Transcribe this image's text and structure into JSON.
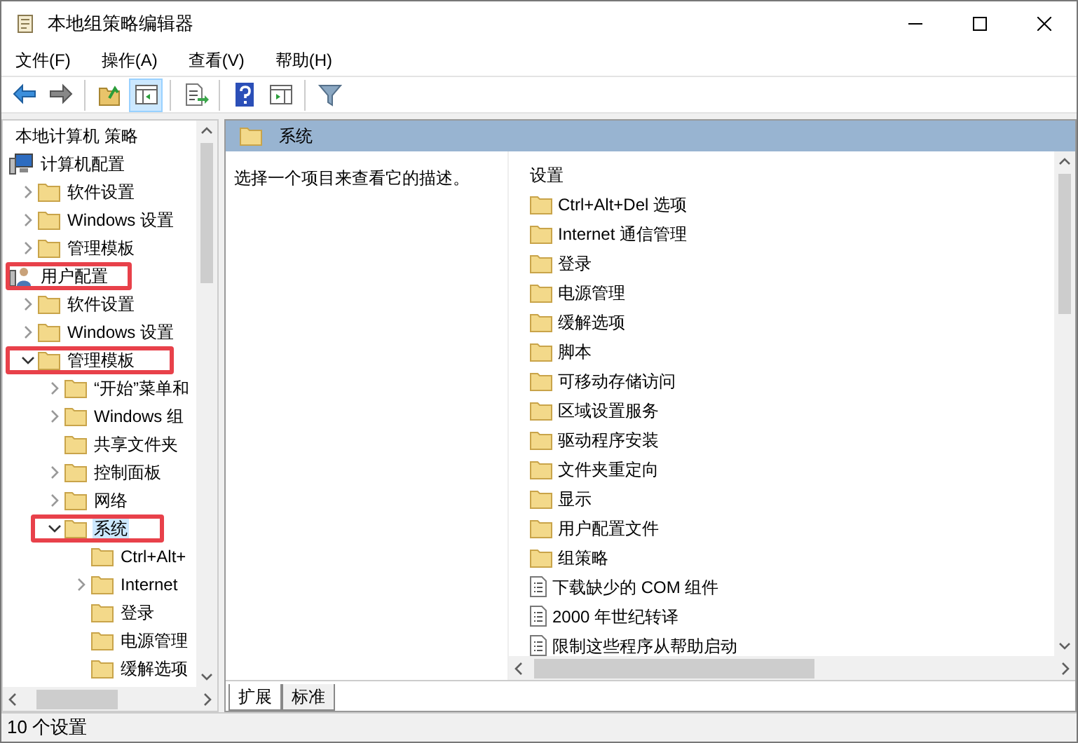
{
  "window": {
    "title": "本地组策略编辑器"
  },
  "menu": [
    "文件(F)",
    "操作(A)",
    "查看(V)",
    "帮助(H)"
  ],
  "toolbar": [
    {
      "kind": "back",
      "pressed": false
    },
    {
      "kind": "forward",
      "pressed": false
    },
    {
      "kind": "sep"
    },
    {
      "kind": "up",
      "pressed": false
    },
    {
      "kind": "tree",
      "pressed": true
    },
    {
      "kind": "sep"
    },
    {
      "kind": "export",
      "pressed": false
    },
    {
      "kind": "sep"
    },
    {
      "kind": "help",
      "pressed": false
    },
    {
      "kind": "pane",
      "pressed": false
    },
    {
      "kind": "sep"
    },
    {
      "kind": "filter",
      "pressed": false
    }
  ],
  "tree": [
    {
      "label": "本地计算机 策略",
      "kind": "root",
      "selected": false,
      "highlighted": false
    },
    {
      "label": "计算机配置",
      "kind": "computer",
      "selected": false,
      "highlighted": false,
      "children": [
        {
          "label": "软件设置",
          "kind": "collapsed",
          "selected": false,
          "highlighted": false
        },
        {
          "label": "Windows 设置",
          "kind": "collapsed",
          "selected": false,
          "highlighted": false
        },
        {
          "label": "管理模板",
          "kind": "collapsed",
          "selected": false,
          "highlighted": false
        }
      ]
    },
    {
      "label": "用户配置",
      "kind": "user",
      "selected": false,
      "highlighted": true,
      "children": [
        {
          "label": "软件设置",
          "kind": "collapsed",
          "selected": false,
          "highlighted": false
        },
        {
          "label": "Windows 设置",
          "kind": "collapsed",
          "selected": false,
          "highlighted": false
        },
        {
          "label": "管理模板",
          "kind": "expanded",
          "selected": false,
          "highlighted": true,
          "children": [
            {
              "label": "“开始”菜单和",
              "kind": "collapsed",
              "selected": false,
              "highlighted": false
            },
            {
              "label": "Windows 组",
              "kind": "collapsed",
              "selected": false,
              "highlighted": false
            },
            {
              "label": "共享文件夹",
              "kind": "leaf",
              "selected": false,
              "highlighted": false
            },
            {
              "label": "控制面板",
              "kind": "collapsed",
              "selected": false,
              "highlighted": false
            },
            {
              "label": "网络",
              "kind": "collapsed",
              "selected": false,
              "highlighted": false
            },
            {
              "label": "系统",
              "kind": "expanded",
              "selected": true,
              "highlighted": true,
              "children": [
                {
                  "label": "Ctrl+Alt+",
                  "kind": "leaf",
                  "selected": false,
                  "highlighted": false
                },
                {
                  "label": "Internet",
                  "kind": "collapsed",
                  "selected": false,
                  "highlighted": false
                },
                {
                  "label": "登录",
                  "kind": "leaf",
                  "selected": false,
                  "highlighted": false
                },
                {
                  "label": "电源管理",
                  "kind": "leaf",
                  "selected": false,
                  "highlighted": false
                },
                {
                  "label": "缓解选项",
                  "kind": "leaf",
                  "selected": false,
                  "highlighted": false
                }
              ]
            }
          ]
        }
      ]
    }
  ],
  "header": {
    "title": "系统"
  },
  "description": "选择一个项目来查看它的描述。",
  "list_heading": "设置",
  "items": [
    {
      "label": "Ctrl+Alt+Del 选项",
      "kind": "folder"
    },
    {
      "label": "Internet 通信管理",
      "kind": "folder"
    },
    {
      "label": "登录",
      "kind": "folder"
    },
    {
      "label": "电源管理",
      "kind": "folder"
    },
    {
      "label": "缓解选项",
      "kind": "folder"
    },
    {
      "label": "脚本",
      "kind": "folder"
    },
    {
      "label": "可移动存储访问",
      "kind": "folder"
    },
    {
      "label": "区域设置服务",
      "kind": "folder"
    },
    {
      "label": "驱动程序安装",
      "kind": "folder"
    },
    {
      "label": "文件夹重定向",
      "kind": "folder"
    },
    {
      "label": "显示",
      "kind": "folder"
    },
    {
      "label": "用户配置文件",
      "kind": "folder"
    },
    {
      "label": "组策略",
      "kind": "folder"
    },
    {
      "label": "下载缺少的 COM 组件",
      "kind": "setting"
    },
    {
      "label": "2000 年世纪转译",
      "kind": "setting"
    },
    {
      "label": "限制这些程序从帮助启动",
      "kind": "setting"
    }
  ],
  "tabs": [
    {
      "label": "扩展",
      "selected": true
    },
    {
      "label": "标准",
      "selected": false
    }
  ],
  "status_bar": "10 个设置"
}
